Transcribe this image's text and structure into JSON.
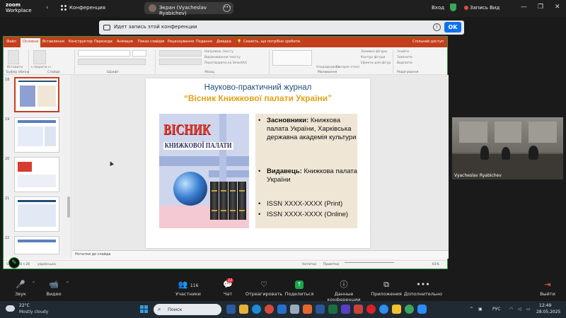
{
  "zoom": {
    "logo_line1": "zoom",
    "logo_line2": "Workplace",
    "conference_label": "Конференция",
    "share_label": "Экран (Vyacheslav Ryabichev)",
    "login_label": "Вход",
    "record_label": "Запись",
    "view_label": "Вид"
  },
  "banner": {
    "text": "Идет запись этой конференции",
    "ok_label": "OK",
    "info_symbol": "i"
  },
  "ppt": {
    "tabs": [
      "Файл",
      "Основне",
      "Вставлення",
      "Конструктор",
      "Переходи",
      "Анімація",
      "Показ слайдів",
      "Рецензування",
      "Подання",
      "Довідка"
    ],
    "active_tab": "Основне",
    "tell_me": "Скажіть, що потрібно зробити",
    "share": "Спільний доступ",
    "groups": [
      "Буфер обміну",
      "Слайди",
      "Шрифт",
      "Абзац",
      "Малювання",
      "Редагування"
    ],
    "ribbon_labels": [
      "Вставити",
      "Створити слайд",
      "Напрямок тексту",
      "Вирівнювання тексту",
      "Перетворити на SmartArt",
      "Упорядкувати",
      "Експрес-стилі",
      "Заливка фігури",
      "Контур фігури",
      "Ефекти для фігур",
      "Знайти",
      "Замінити",
      "Виділити"
    ],
    "thumb_numbers": [
      "18",
      "19",
      "20",
      "21",
      "22"
    ],
    "notes_placeholder": "Нотатки до слайда",
    "status_left": "Слайд 18 з 28",
    "status_lang": "українська",
    "status_notes": "Нотатки",
    "status_comments": "Примітки",
    "zoom_level": "61%"
  },
  "slide": {
    "title_line1": "Науково-практичний журнал",
    "title_line2": "“Вісник Книжкової палати України”",
    "cover_title": "ВІСНИК",
    "cover_subtitle": "КНИЖКОВОЇ ПАЛАТИ",
    "bullets": [
      {
        "bold": "Засновники:",
        "text": " Книжкова палата України, Харківська державна академія культури"
      },
      {
        "bold": "Видавець:",
        "text": " Книжкова палата України"
      },
      {
        "bold": "",
        "text": "ISSN XXXX-XXXX (Print)"
      },
      {
        "bold": "",
        "text": "ISSN XXXX-XXXX (Online)"
      }
    ],
    "bullet_symbol": "•"
  },
  "video": {
    "name": "Vyacheslav Ryabichev"
  },
  "controls": {
    "mute": "Звук",
    "video": "Видео",
    "participants": "Участники",
    "participants_count": "116",
    "chat": "Чат",
    "chat_badge": "22",
    "react": "Отреагировать",
    "share": "Поделиться",
    "meeting_info": "Данные конференции",
    "apps": "Приложения",
    "more": "Дополнительно",
    "leave": "Выйти"
  },
  "taskbar": {
    "temperature": "22°C",
    "weather": "Mostly cloudy",
    "search_placeholder": "Поиск",
    "language": "РУС",
    "time": "12:49",
    "date": "28.05.2025"
  },
  "colors": {
    "ppt_accent": "#c43e1c",
    "zoom_ok": "#0e71eb",
    "slide_title": "#1f4e79",
    "slide_subtitle": "#e1a21a"
  }
}
